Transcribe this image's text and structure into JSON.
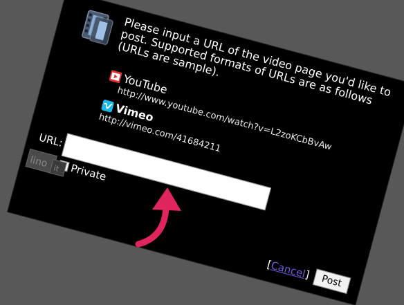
{
  "prompt_text": "Please input a URL of the video page you'd like to post. Supported formats of URLs are as follows (URLs are sample).",
  "formats": [
    {
      "name": "YouTube",
      "icon": "youtube-icon",
      "sample_url": "http://www.youtube.com/watch?v=L2zoKCbBvAw"
    },
    {
      "name": "Vimeo",
      "icon": "vimeo-icon",
      "sample_url": "http://vimeo.com/41684211"
    }
  ],
  "url_field": {
    "label": "URL:",
    "value": ""
  },
  "private_checkbox": {
    "label": "Private",
    "checked": false
  },
  "footer": {
    "bracket_open": "[",
    "cancel_label": "Cancel",
    "bracket_close": "]",
    "post_label": "Post"
  },
  "logo_text": "lino it",
  "colors": {
    "background": "#585858",
    "dialog": "#000000",
    "cancel_link": "#6b5bd6",
    "arrow": "#e0245e",
    "youtube": "#e03030",
    "vimeo": "#1ab7ea"
  }
}
